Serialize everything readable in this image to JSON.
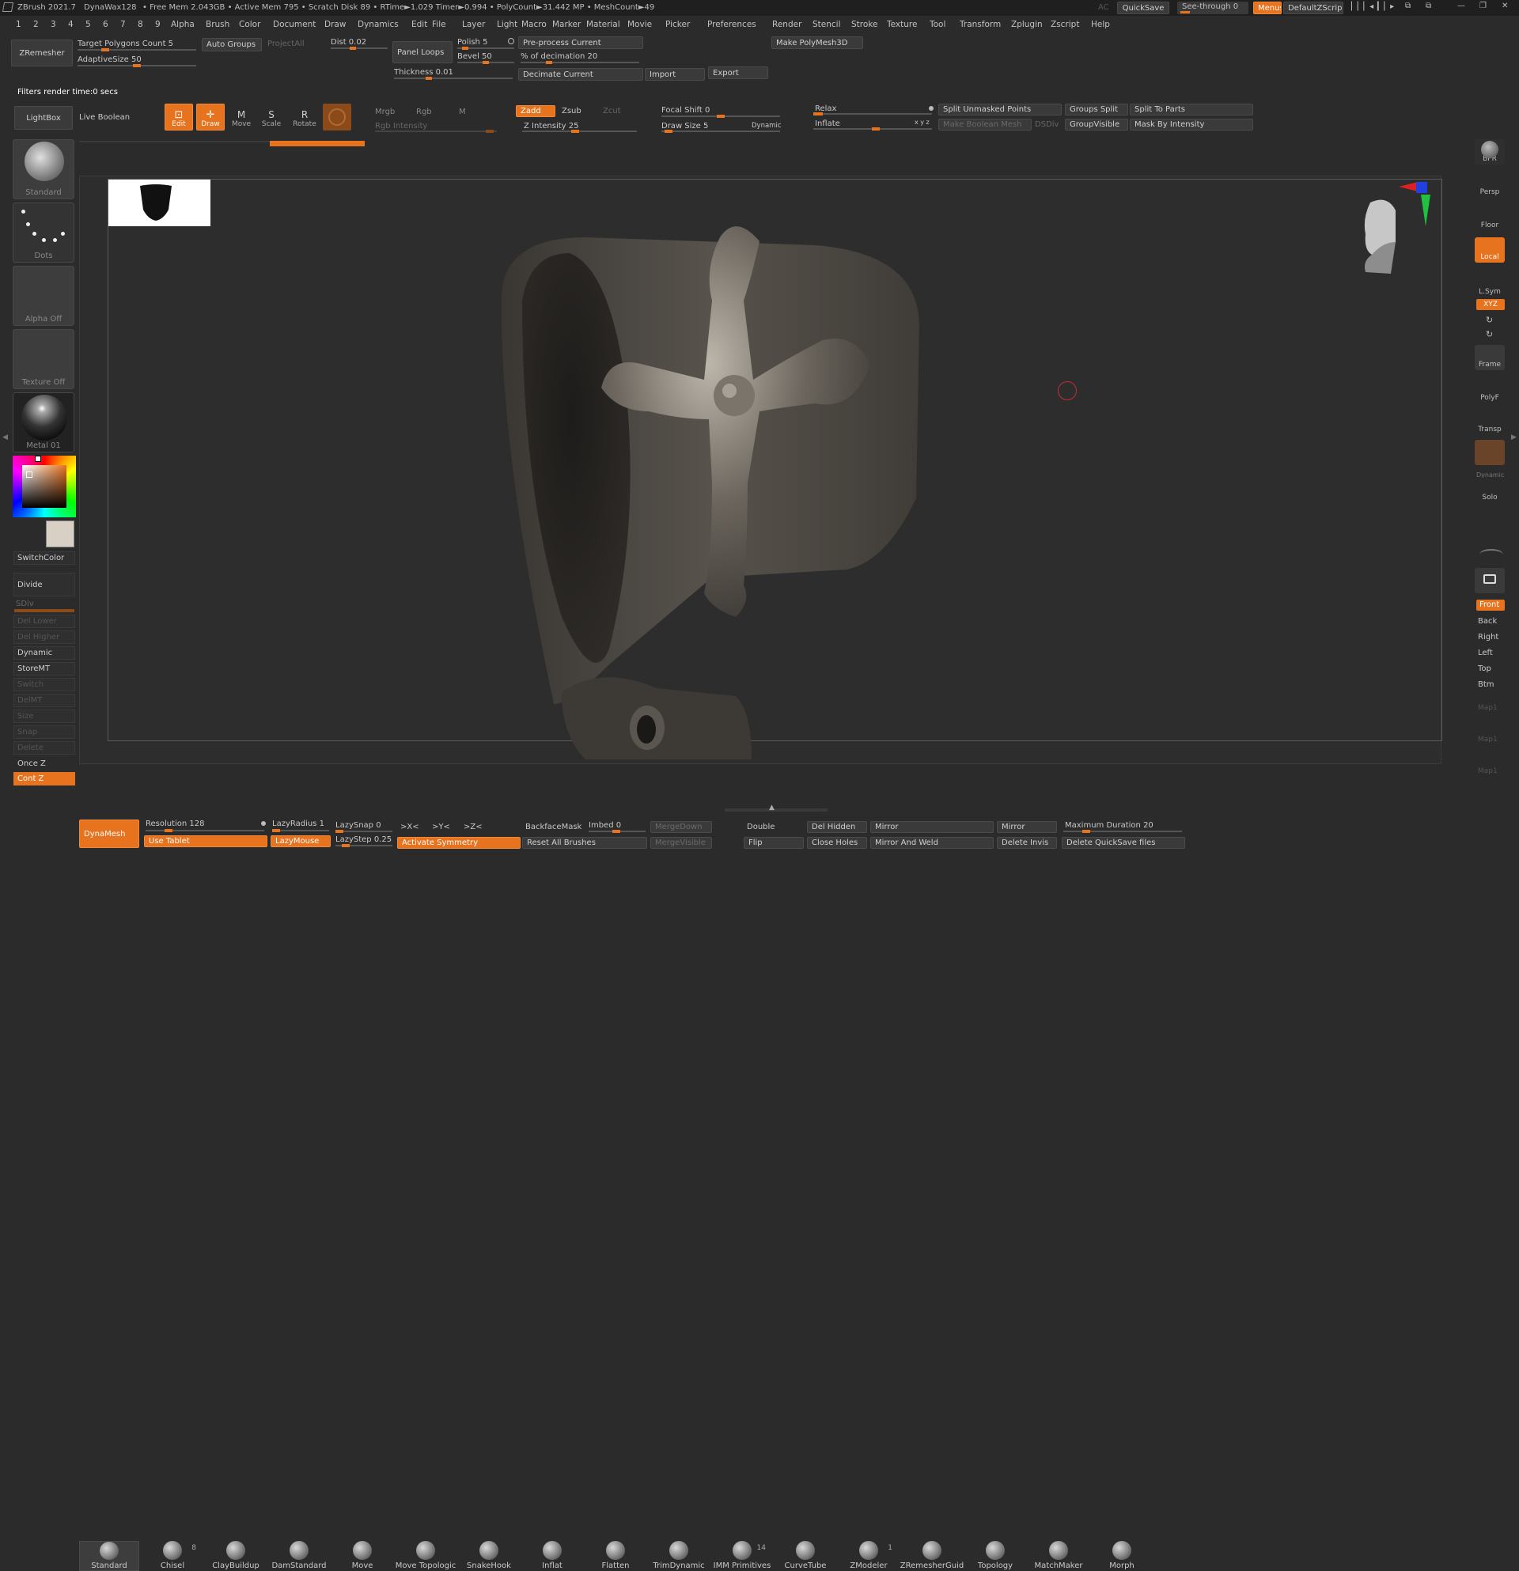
{
  "titlebar": {
    "app": "ZBrush 2021.7",
    "doc": "DynaWax128",
    "stats": "• Free Mem 2.043GB • Active Mem 795 • Scratch Disk 89 • RTime►1.029 Timer►0.994 • PolyCount►31.442 MP • MeshCount►49",
    "ac": "AC",
    "quicksave": "QuickSave",
    "seethrough": "See-through  0",
    "menus": "Menus",
    "script": "DefaultZScript"
  },
  "menubar": [
    "1",
    "2",
    "3",
    "4",
    "5",
    "6",
    "7",
    "8",
    "9",
    "Alpha",
    "Brush",
    "Color",
    "Document",
    "Draw",
    "Dynamics",
    "Edit",
    "File",
    "Layer",
    "Light",
    "Macro",
    "Marker",
    "Material",
    "Movie",
    "Picker",
    "Preferences",
    "Render",
    "Stencil",
    "Stroke",
    "Texture",
    "Tool",
    "Transform",
    "Zplugin",
    "Zscript",
    "Help"
  ],
  "zremesher": {
    "button": "ZRemesher",
    "target": "Target Polygons Count 5",
    "adaptive": "AdaptiveSize 50",
    "autogroups": "Auto Groups",
    "projectall": "ProjectAll",
    "dist": "Dist 0.02",
    "panelloops": "Panel Loops",
    "thickness": "Thickness 0.01",
    "polish": "Polish 5",
    "bevel": "Bevel 50",
    "preprocess": "Pre-process Current",
    "pct_decimation": "% of decimation 20",
    "decimate": "Decimate Current",
    "import": "Import",
    "export": "Export",
    "makepoly": "Make PolyMesh3D"
  },
  "filters": "Filters render time:0 secs",
  "toolbar": {
    "lightbox": "LightBox",
    "liveboolean": "Live Boolean",
    "edit": "Edit",
    "draw": "Draw",
    "move": "Move",
    "scale": "Scale",
    "rotate": "Rotate",
    "mrgb": "Mrgb",
    "rgb": "Rgb",
    "m": "M",
    "rgbintensity": "Rgb Intensity",
    "zadd": "Zadd",
    "zsub": "Zsub",
    "zcut": "Zcut",
    "zintensity": "Z Intensity 25",
    "focalshift": "Focal Shift 0",
    "drawsize": "Draw Size 5",
    "dynamic": "Dynamic",
    "relax": "Relax",
    "inflate": "Inflate",
    "splitunmasked": "Split Unmasked Points",
    "groupssplit": "Groups Split",
    "splittoparts": "Split To Parts",
    "makeboolean": "Make Boolean Mesh",
    "dsdiv": "DSDiv",
    "groupvisible": "GroupVisible",
    "maskbyintensity": "Mask By Intensity"
  },
  "left": {
    "thumbs": [
      "Standard",
      "Dots",
      "Alpha Off",
      "Texture Off",
      "Metal 01"
    ],
    "switchcolor": "SwitchColor",
    "divide": "Divide",
    "sdiv": "SDiv",
    "dellower": "Del Lower",
    "delhigher": "Del Higher",
    "dynamic": "Dynamic",
    "storemt": "StoreMT",
    "switch": "Switch",
    "delmt": "DelMT",
    "size": "Size",
    "snap": "Snap",
    "delete": "Delete",
    "oncez": "Once Z",
    "contz": "Cont Z"
  },
  "right": {
    "bpr": "BPR",
    "persp": "Persp",
    "floor": "Floor",
    "local": "Local",
    "lsym": "L.Sym",
    "xyz": "XYZ",
    "frame": "Frame",
    "polyf": "PolyF",
    "transp": "Transp",
    "dynamic": "Dynamic",
    "solo": "Solo",
    "views": [
      "Front",
      "Back",
      "Right",
      "Left",
      "Top",
      "Btm"
    ],
    "map1": "Map1"
  },
  "brushes": [
    {
      "name": "Standard"
    },
    {
      "name": "Chisel",
      "count": "8"
    },
    {
      "name": "ClayBuildup"
    },
    {
      "name": "DamStandard"
    },
    {
      "name": "Move"
    },
    {
      "name": "Move Topologic"
    },
    {
      "name": "SnakeHook"
    },
    {
      "name": "Inflat"
    },
    {
      "name": "Flatten"
    },
    {
      "name": "TrimDynamic"
    },
    {
      "name": "IMM Primitives",
      "count": "14"
    },
    {
      "name": "CurveTube"
    },
    {
      "name": "ZModeler",
      "count": "1"
    },
    {
      "name": "ZRemesherGuid"
    },
    {
      "name": "Topology"
    },
    {
      "name": "MatchMaker"
    },
    {
      "name": "Morph"
    }
  ],
  "bottom": {
    "dynamesh": "DynaMesh",
    "resolution": "Resolution 128",
    "usetablet": "Use Tablet",
    "lazyradius": "LazyRadius 1",
    "lazymouse": "LazyMouse",
    "lazysnap": "LazySnap 0",
    "lazystep": "LazyStep 0.25",
    "sym1": ">X<",
    "sym2": ">Y<",
    "sym3": ">Z<",
    "activatesym": "Activate Symmetry",
    "backfacemask": "BackfaceMask",
    "imbed": "Imbed 0",
    "resetallbrushes": "Reset All Brushes",
    "mergedown": "MergeDown",
    "mergevisible": "MergeVisible",
    "double": "Double",
    "flip": "Flip",
    "delhidden": "Del Hidden",
    "closeholes": "Close Holes",
    "mirror1": "Mirror",
    "mirrorweld": "Mirror And Weld",
    "mirror2": "Mirror",
    "deleteinvis": "Delete Invis",
    "maxduration": "Maximum Duration 20",
    "deletequicksave": "Delete QuickSave files"
  },
  "colors": {
    "accent": "#e8731f",
    "bg": "#2b2b2b",
    "panel": "#3a3a3a"
  }
}
